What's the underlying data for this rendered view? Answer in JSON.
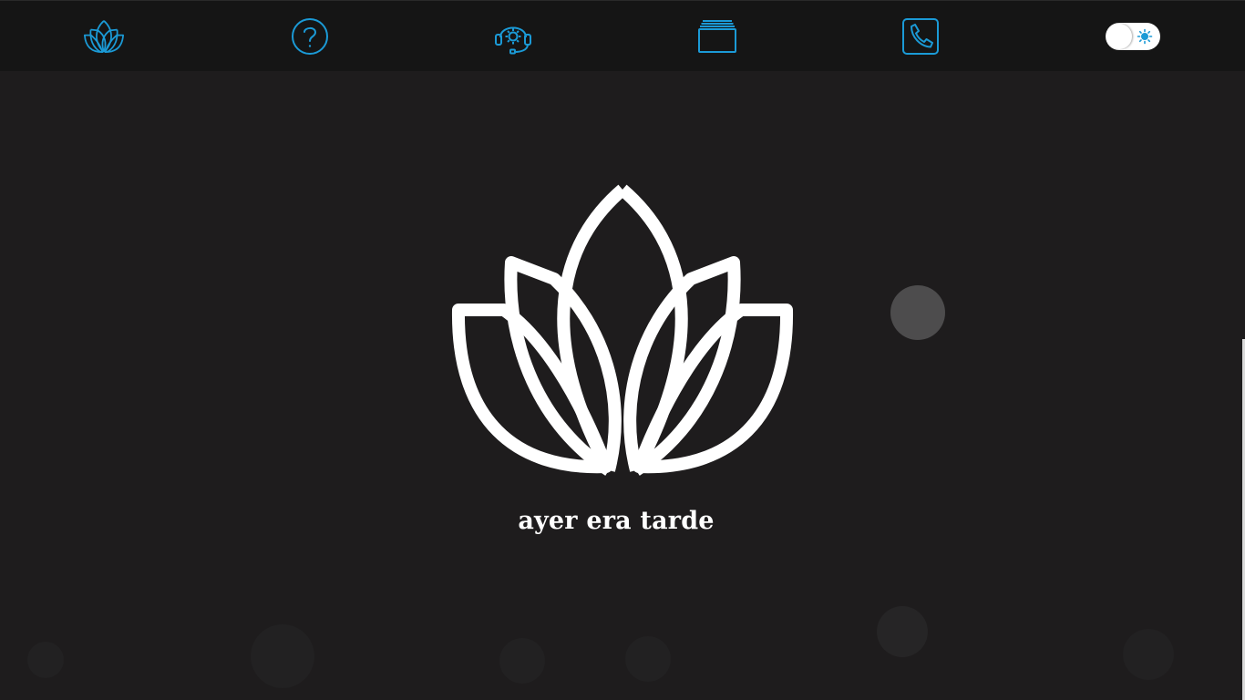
{
  "nav": {
    "accent_color": "#1b9ad6",
    "items": [
      {
        "icon": "lotus-icon",
        "name": "home"
      },
      {
        "icon": "help-icon",
        "name": "faq"
      },
      {
        "icon": "support-headset-icon",
        "name": "support"
      },
      {
        "icon": "folders-icon",
        "name": "portfolio"
      },
      {
        "icon": "phone-icon",
        "name": "contact"
      }
    ],
    "theme_toggle": {
      "icon": "sun-icon",
      "state": "dark"
    }
  },
  "hero": {
    "logo_icon": "lotus-icon",
    "logo_color": "#ffffff",
    "title": "ayer era tarde"
  },
  "background": {
    "color": "#1e1c1d"
  }
}
